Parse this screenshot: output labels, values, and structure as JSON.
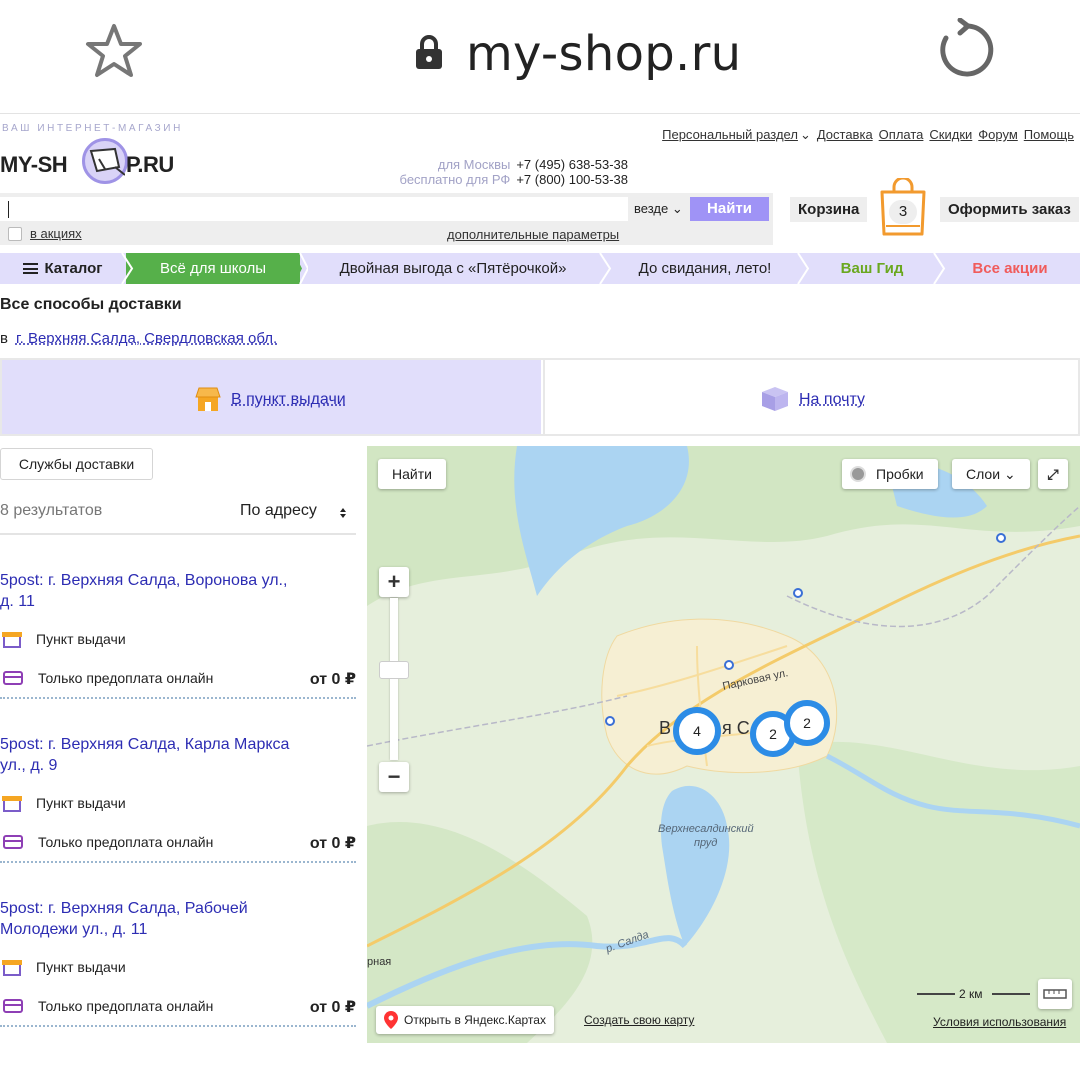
{
  "browser": {
    "url": "my-shop.ru"
  },
  "header": {
    "tagline": "ВАШ ИНТЕРНЕТ-МАГАЗИН",
    "logo_left": "MY-SH",
    "logo_right": "P.RU",
    "links": [
      "Персональный раздел",
      "Доставка",
      "Оплата",
      "Скидки",
      "Форум",
      "Помощь"
    ],
    "phone_moscow_label": "для Москвы",
    "phone_moscow": "+7 (495) 638-53-38",
    "phone_rf_label": "бесплатно для РФ",
    "phone_rf": "+7 (800) 100-53-38"
  },
  "search": {
    "value": "",
    "scope": "везде",
    "button": "Найти",
    "promo_label": "в акциях",
    "advanced_label": "дополнительные параметры"
  },
  "cart": {
    "label": "Корзина",
    "count": "3",
    "checkout": "Оформить заказ"
  },
  "nav": {
    "catalog": "Каталог",
    "items": [
      "Всё для школы",
      "Двойная выгода с «Пятёрочкой»",
      "До свидания, лето!",
      "Ваш Гид",
      "Все акции"
    ],
    "colors": {
      "school_bg": "#56b04a",
      "guide": "#6aa81f",
      "sales": "#f05c5c",
      "nav_bg": "#e1defb"
    }
  },
  "delivery": {
    "title": "Все способы доставки",
    "city_prefix": "в",
    "city": "г. Верхняя Салда, Свердловская обл.",
    "tabs": [
      "В пункт выдачи",
      "На почту"
    ]
  },
  "list": {
    "services_button": "Службы доставки",
    "results_count": "8 результатов",
    "sort_label": "По адресу",
    "results": [
      {
        "title": "5post: г. Верхняя Салда, Воронова ул., д. 11",
        "type": "Пункт выдачи",
        "payment": "Только предоплата онлайн",
        "price": "от 0 ₽"
      },
      {
        "title": "5post: г. Верхняя Салда, Карла Маркса ул., д. 9",
        "type": "Пункт выдачи",
        "payment": "Только предоплата онлайн",
        "price": "от 0 ₽"
      },
      {
        "title": "5post: г. Верхняя Салда, Рабочей Молодежи ул., д. 11",
        "type": "Пункт выдачи",
        "payment": "Только предоплата онлайн",
        "price": "от 0 ₽"
      }
    ]
  },
  "map": {
    "find_button": "Найти",
    "traffic_button": "Пробки",
    "layers_button": "Слои",
    "zoom_in": "+",
    "zoom_out": "−",
    "clusters": [
      "4",
      "2",
      "2"
    ],
    "street_label": "Парковая ул.",
    "pond_label_1": "Верхнесалдинский",
    "pond_label_2": "пруд",
    "river_label": "р. Салда",
    "city_partial_1": "В",
    "city_partial_2": "я С",
    "edge_label": "рная",
    "scale": "2 км",
    "open_yandex": "Открыть в Яндекс.Картах",
    "create_map": "Создать свою карту",
    "terms": "Условия использования"
  }
}
